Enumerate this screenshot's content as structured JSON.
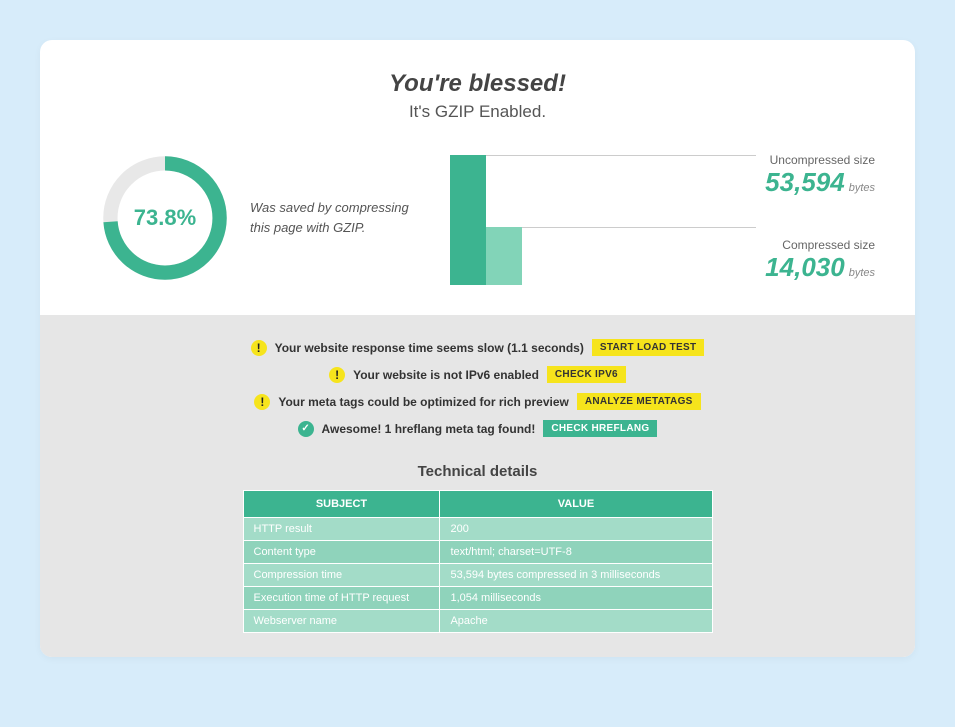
{
  "heading": "You're blessed!",
  "subheading": "It's GZIP Enabled.",
  "gauge": {
    "percent_label": "73.8%",
    "percent_value": 73.8,
    "caption": "Was saved by compressing this page with GZIP."
  },
  "chart_data": {
    "type": "bar",
    "categories": [
      "Uncompressed size",
      "Compressed size"
    ],
    "values": [
      53594,
      14030
    ],
    "unit": "bytes",
    "title": "",
    "xlabel": "",
    "ylabel": "",
    "ylim": [
      0,
      53594
    ]
  },
  "stats": {
    "uncompressed": {
      "label": "Uncompressed size",
      "value": "53,594",
      "unit": "bytes"
    },
    "compressed": {
      "label": "Compressed size",
      "value": "14,030",
      "unit": "bytes"
    }
  },
  "alerts": [
    {
      "type": "warn",
      "text": "Your website response time seems slow (1.1 seconds)",
      "button": "START LOAD TEST"
    },
    {
      "type": "warn",
      "text": "Your website is not IPv6 enabled",
      "button": "CHECK IPV6"
    },
    {
      "type": "warn",
      "text": "Your meta tags could be optimized for rich preview",
      "button": "ANALYZE METATAGS"
    },
    {
      "type": "ok",
      "text": "Awesome! 1 hreflang meta tag found!",
      "button": "CHECK HREFLANG"
    }
  ],
  "tech": {
    "heading": "Technical details",
    "headers": {
      "subject": "SUBJECT",
      "value": "VALUE"
    },
    "rows": [
      {
        "subject": "HTTP result",
        "value": "200"
      },
      {
        "subject": "Content type",
        "value": "text/html; charset=UTF-8"
      },
      {
        "subject": "Compression time",
        "value": "53,594 bytes compressed in 3 milliseconds"
      },
      {
        "subject": "Execution time of HTTP request",
        "value": "1,054 milliseconds"
      },
      {
        "subject": "Webserver name",
        "value": "Apache"
      }
    ]
  }
}
